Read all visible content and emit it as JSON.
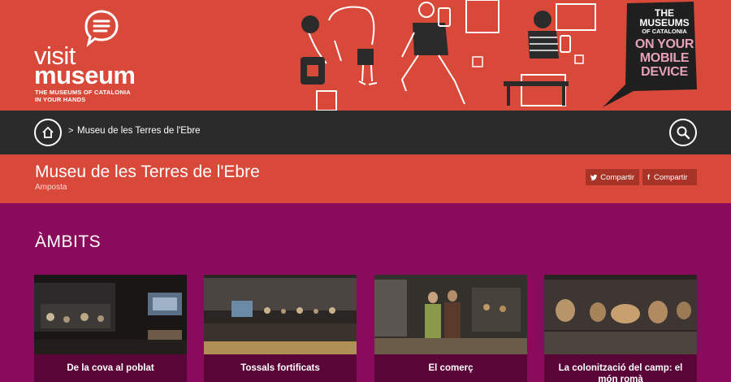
{
  "brand": {
    "visit": "visit",
    "museum": "museum",
    "tagline_line1": "THE MUSEUMS OF CATALONIA",
    "tagline_line2": "IN YOUR HANDS"
  },
  "promo": {
    "line1": "THE MUSEUMS",
    "line2": "OF CATALONIA",
    "line3a": "ON YOUR",
    "line3b": "MOBILE",
    "line3c": "DEVICE"
  },
  "nav": {
    "separator": ">",
    "breadcrumb": "Museu de les Terres de l'Ebre"
  },
  "page": {
    "title": "Museu de les Terres de l'Ebre",
    "subtitle": "Amposta"
  },
  "share": {
    "twitter_label": "Compartir",
    "facebook_label": "Compartir",
    "facebook_letter": "f"
  },
  "section": {
    "title": "ÀMBITS"
  },
  "cards": [
    {
      "label": "De la cova al poblat"
    },
    {
      "label": "Tossals fortificats"
    },
    {
      "label": "El comerç"
    },
    {
      "label": "La colonització del camp: el món romà"
    }
  ],
  "colors": {
    "banner": "#d9493a",
    "navbar": "#2b2b2b",
    "main_bg": "#8a0a5c",
    "share_bg": "#a83327"
  }
}
